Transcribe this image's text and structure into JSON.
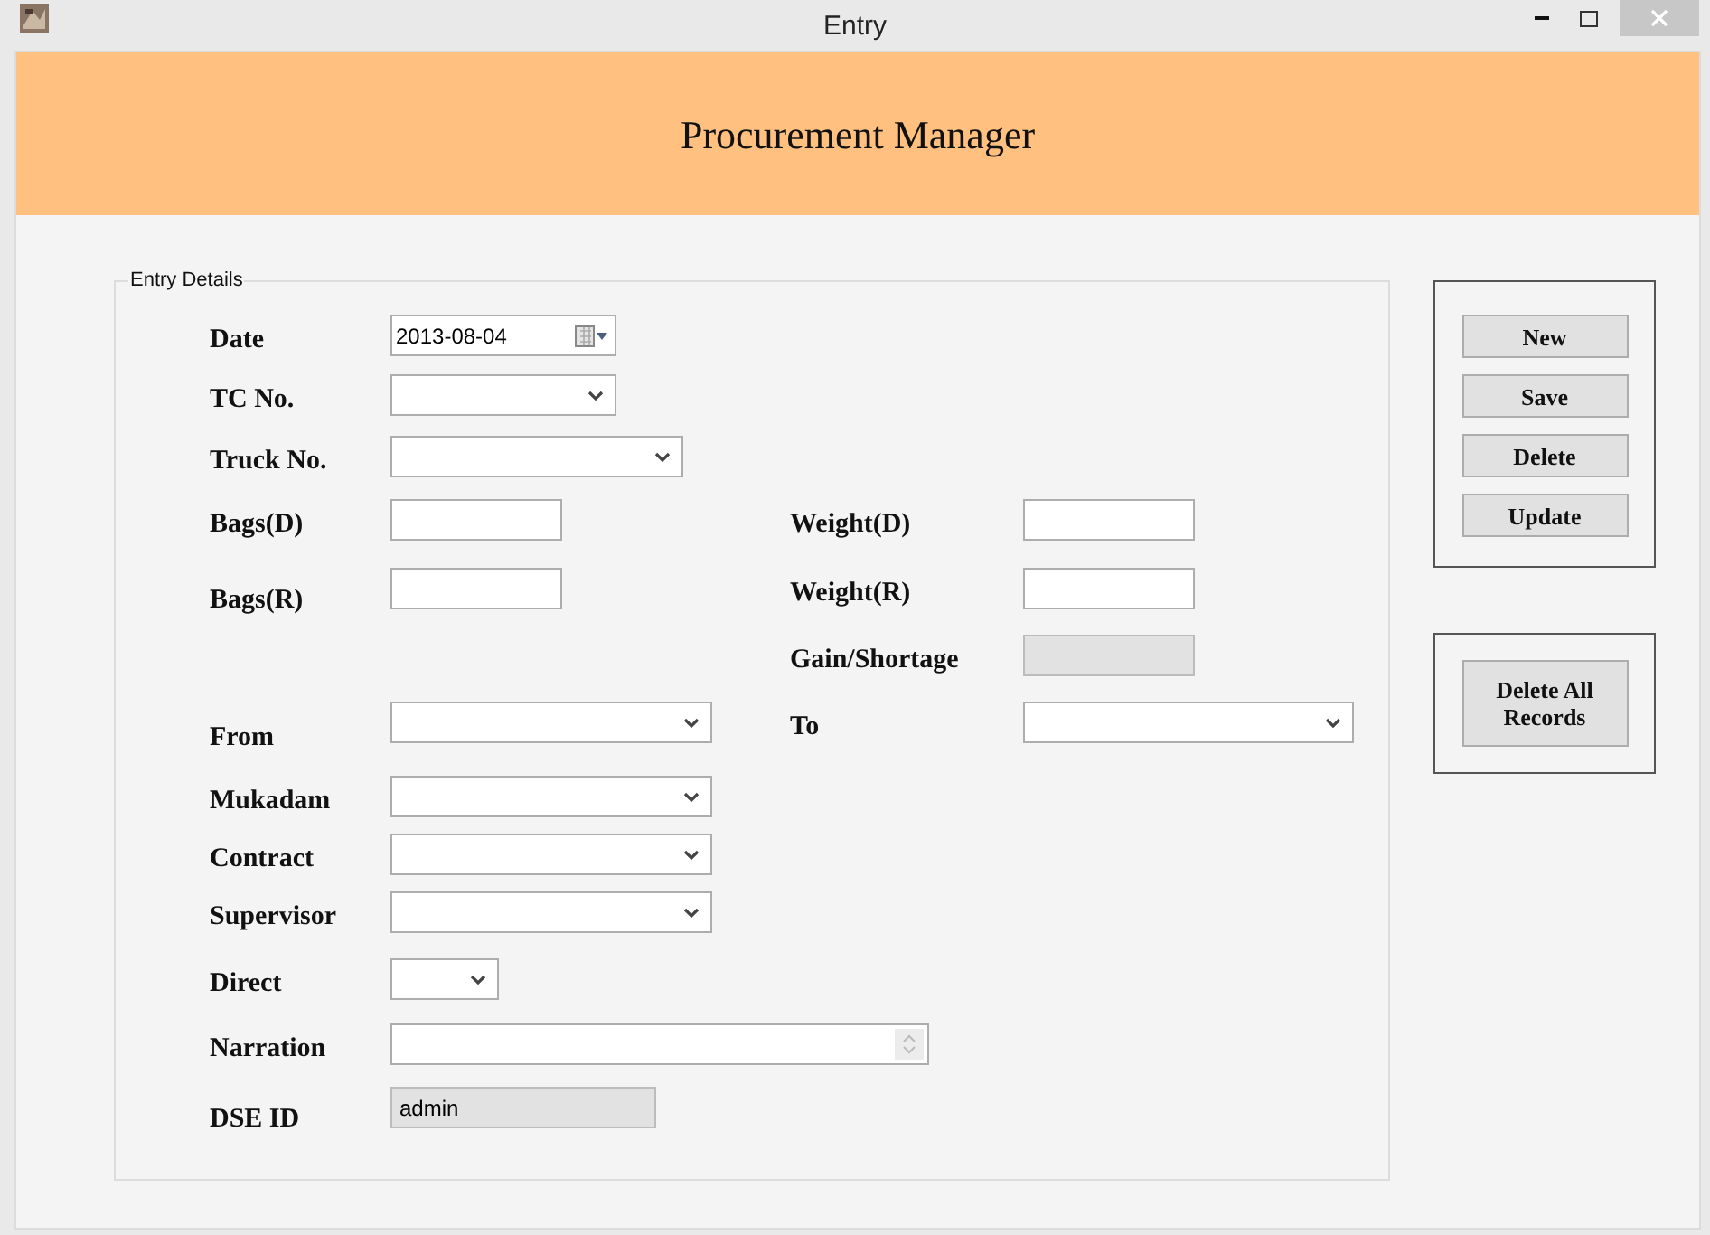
{
  "window": {
    "title": "Entry"
  },
  "header": {
    "title": "Procurement Manager"
  },
  "group": {
    "legend": "Entry Details"
  },
  "rows": [
    {
      "left": {
        "label": "Date",
        "kind": "date",
        "value": "2013-08-04",
        "disabled": false
      }
    },
    {
      "left": {
        "label": "TC No.",
        "kind": "combo",
        "disabled": false
      }
    },
    {
      "left": {
        "label": "Truck No.",
        "kind": "combo",
        "disabled": false
      }
    },
    {
      "left": {
        "label": "Bags(D)",
        "kind": "text",
        "disabled": false
      },
      "right": {
        "label": "Weight(D)",
        "kind": "text",
        "disabled": false
      }
    },
    {
      "left": {
        "label": "Bags(R)",
        "kind": "text",
        "disabled": false
      },
      "right": {
        "label": "Weight(R)",
        "kind": "text",
        "disabled": false
      }
    },
    {
      "right": {
        "label": "Gain/Shortage",
        "kind": "text",
        "disabled": true
      }
    },
    {
      "left": {
        "label": "From",
        "kind": "combo",
        "disabled": false
      },
      "right": {
        "label": "To",
        "kind": "combo",
        "disabled": false
      }
    },
    {
      "left": {
        "label": "Mukadam",
        "kind": "combo",
        "disabled": false
      }
    },
    {
      "left": {
        "label": "Contract",
        "kind": "combo",
        "disabled": false
      }
    },
    {
      "left": {
        "label": "Supervisor",
        "kind": "combo",
        "disabled": false
      }
    },
    {
      "left": {
        "label": "Direct",
        "kind": "combo",
        "disabled": false
      }
    },
    {
      "left": {
        "label": "Narration",
        "kind": "spin",
        "disabled": false
      }
    },
    {
      "left": {
        "label": "DSE ID",
        "kind": "text",
        "value": "admin",
        "disabled": true
      }
    }
  ],
  "actions": [
    "New",
    "Save",
    "Delete",
    "Update"
  ],
  "bulk_action": "Delete All Records"
}
